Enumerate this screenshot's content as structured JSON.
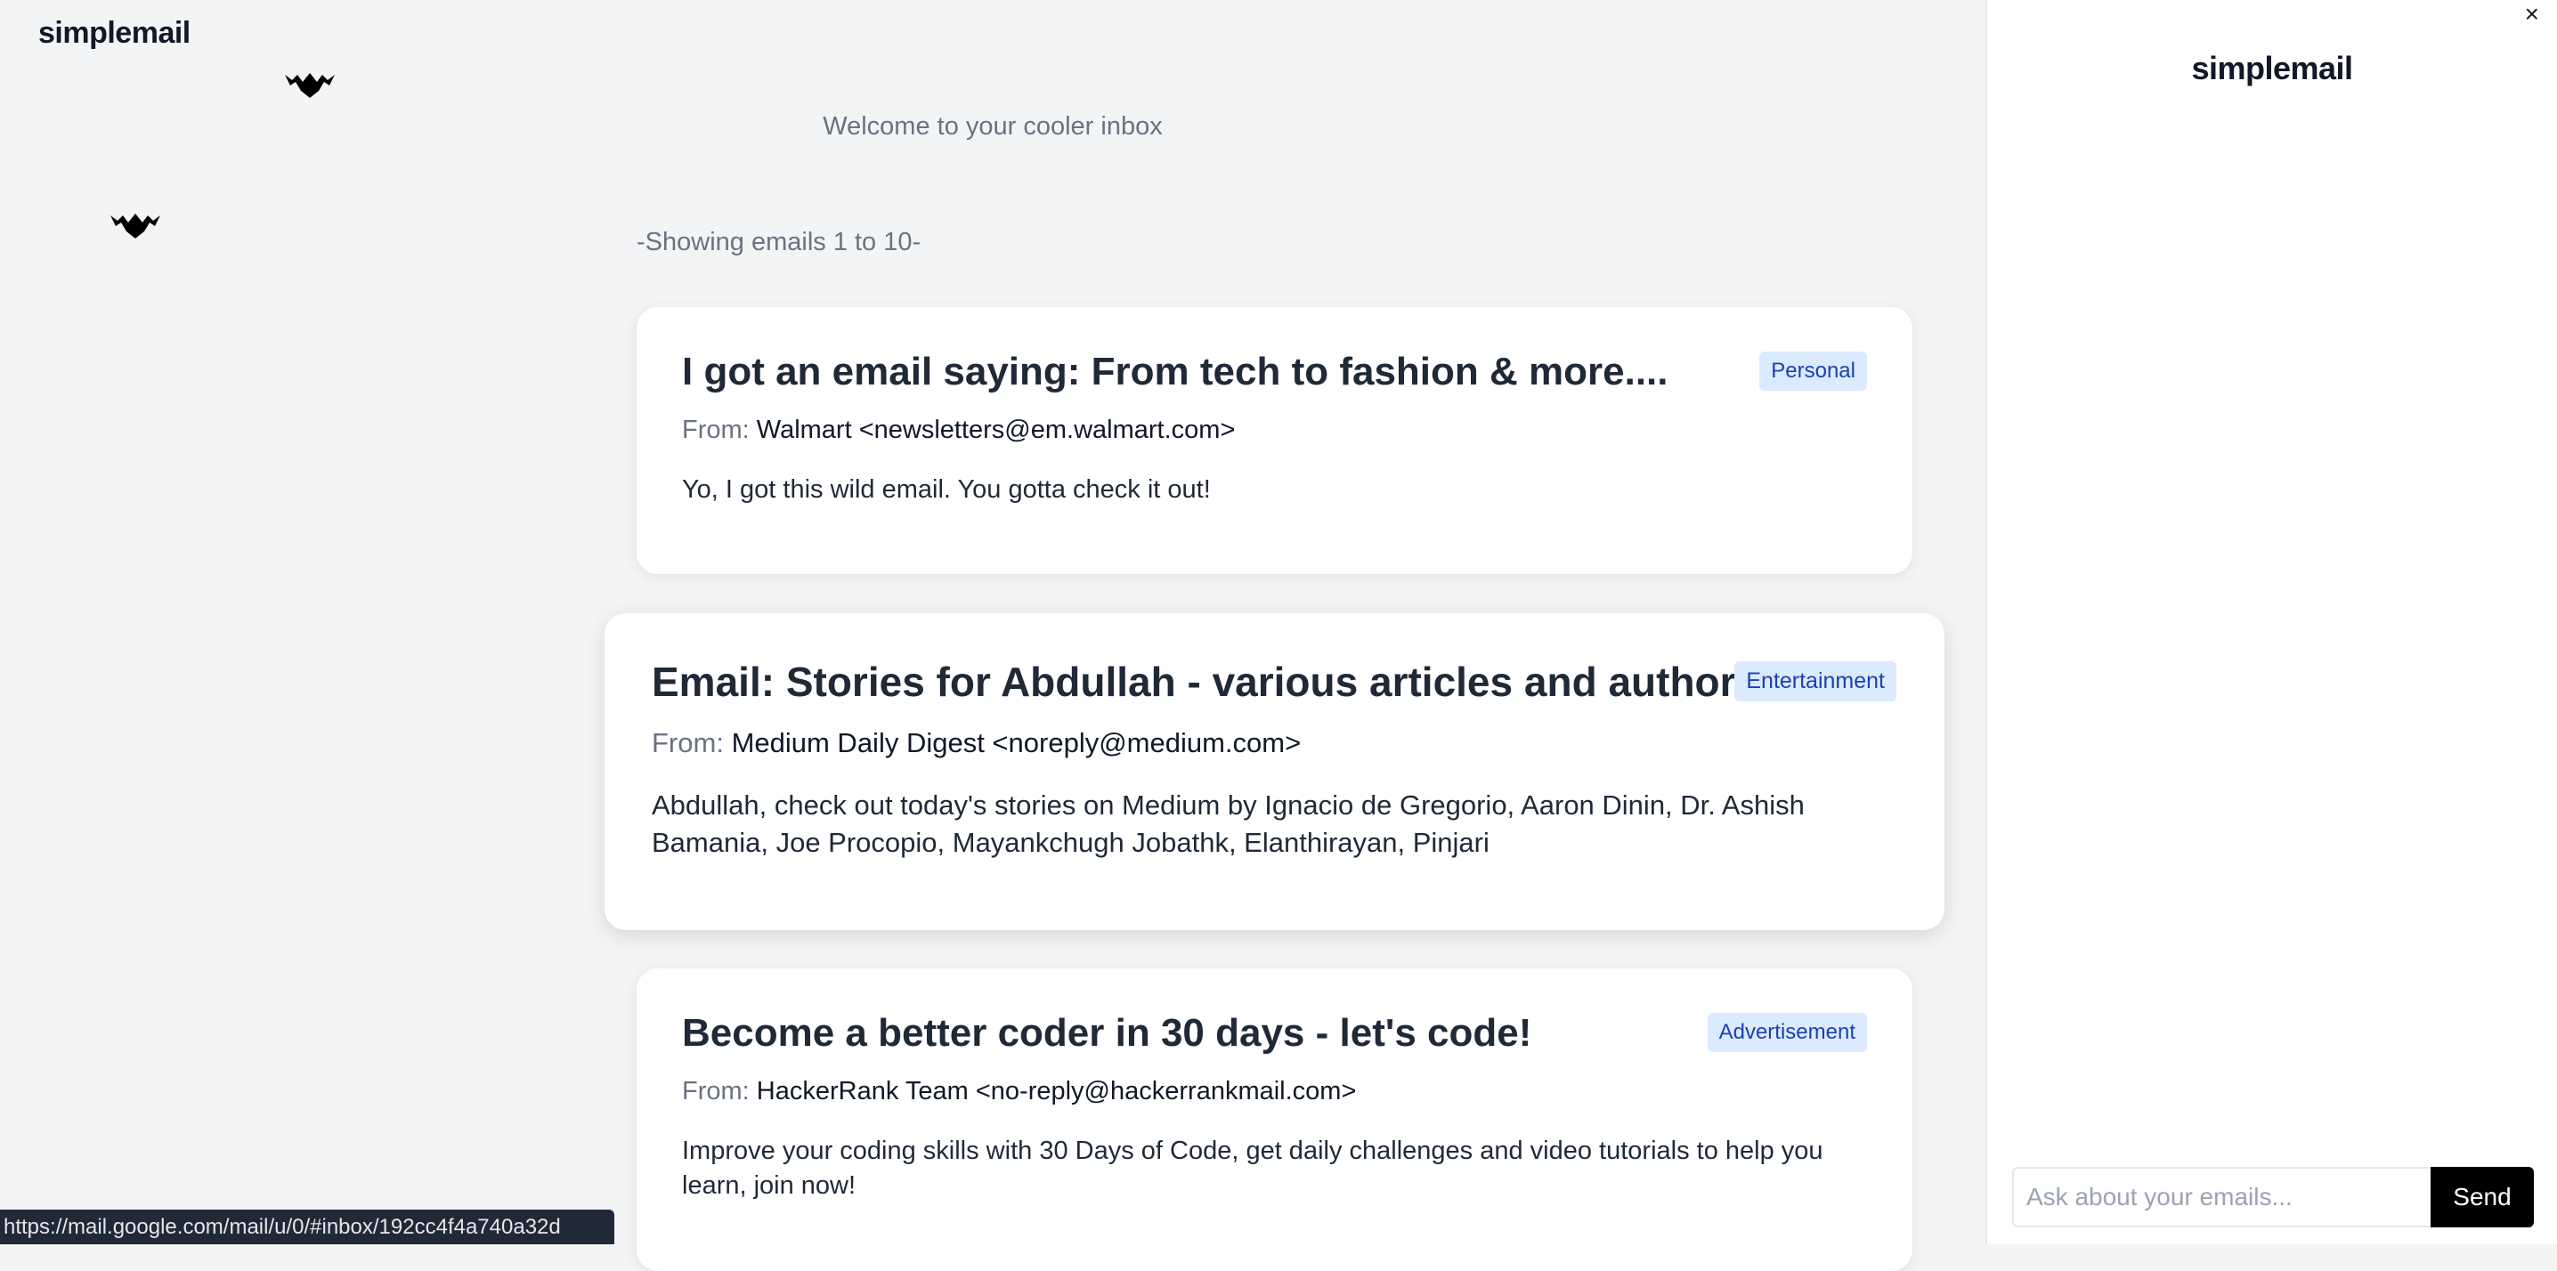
{
  "app": {
    "brand": "simplemail"
  },
  "inbox": {
    "welcome": "Welcome to your cooler inbox",
    "showing": "-Showing emails 1 to 10-"
  },
  "emails": [
    {
      "subject": "I got an email saying: From tech to fashion & more....",
      "from_label": "From:",
      "from": "Walmart <newsletters@em.walmart.com>",
      "summary": "Yo, I got this wild email. You gotta check it out!",
      "tag": "Personal"
    },
    {
      "subject": "Email: Stories for Abdullah - various articles and authors.",
      "from_label": "From:",
      "from": "Medium Daily Digest <noreply@medium.com>",
      "summary": "Abdullah, check out today's stories on Medium by Ignacio de Gregorio, Aaron Dinin, Dr. Ashish Bamania, Joe Procopio, Mayankchugh Jobathk, Elanthirayan, Pinjari",
      "tag": "Entertainment"
    },
    {
      "subject": "Become a better coder in 30 days - let's code!",
      "from_label": "From:",
      "from": "HackerRank Team <no-reply@hackerrankmail.com>",
      "summary": "Improve your coding skills with 30 Days of Code, get daily challenges and video tutorials to help you learn, join now!",
      "tag": "Advertisement"
    }
  ],
  "status_bar": {
    "url": "https://mail.google.com/mail/u/0/#inbox/192cc4f4a740a32d"
  },
  "side_panel": {
    "title": "simplemail",
    "close": "×",
    "input_placeholder": "Ask about your emails...",
    "send_label": "Send"
  },
  "icons": [
    "bat-icon",
    "close-icon"
  ]
}
